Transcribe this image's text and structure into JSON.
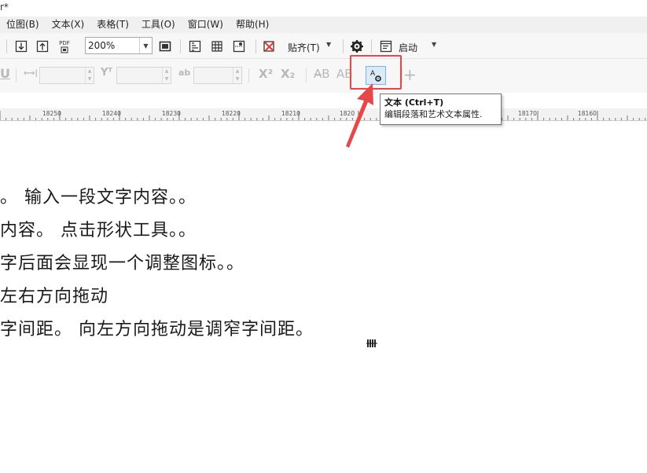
{
  "window": {
    "title_fragment": "r*"
  },
  "menu": [
    "位图(B)",
    "文本(X)",
    "表格(T)",
    "工具(O)",
    "窗口(W)",
    "帮助(H)"
  ],
  "toolbar": {
    "pdf_label": "PDF",
    "zoom_value": "200%",
    "snap_label": "贴齐(T)",
    "launch_label": "启动"
  },
  "property_bar": {
    "superscript": "X²",
    "subscript": "X₂",
    "plus": "+"
  },
  "ruler": {
    "labels": [
      "18250",
      "18240",
      "18230",
      "18220",
      "18210",
      "1820",
      "18170",
      "18160"
    ]
  },
  "tooltip": {
    "title": "文本 (Ctrl+T)",
    "description": "编辑段落和艺术文本属性."
  },
  "document": {
    "lines": [
      "。 输入一段文字内容。。",
      "内容。 点击形状工具。。",
      "字后面会显现一个调整图标。。",
      "左右方向拖动",
      "字间距。 向左方向拖动是调窄字间距。"
    ]
  },
  "colors": {
    "highlight": "#e8474a",
    "arrow": "#e8474a",
    "active_button": "#dbeaf8"
  }
}
